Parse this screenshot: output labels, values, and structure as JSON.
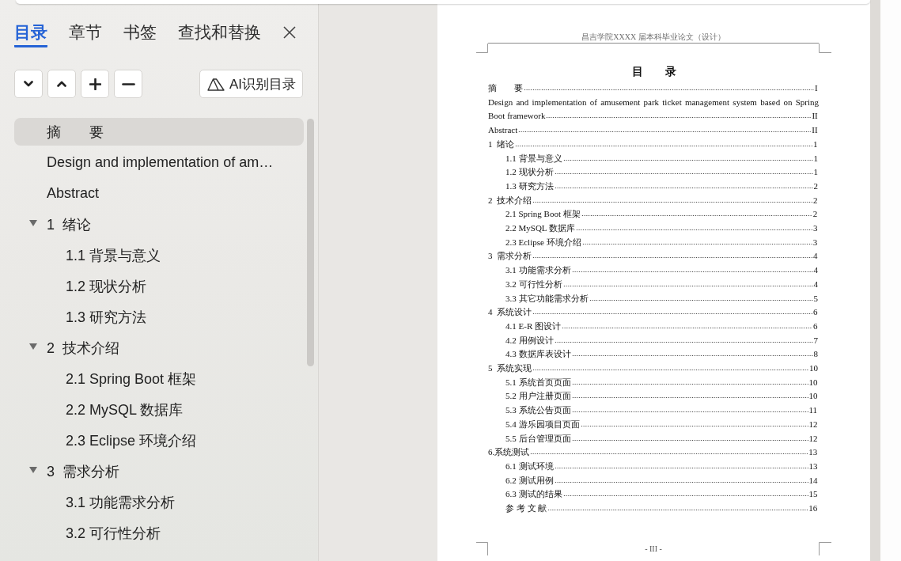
{
  "panel": {
    "tabs": [
      {
        "label": "目录",
        "selected": true
      },
      {
        "label": "章节",
        "selected": false
      },
      {
        "label": "书签",
        "selected": false
      },
      {
        "label": "查找和替换",
        "selected": false
      }
    ],
    "ai_button": "AI识别目录",
    "outline": [
      {
        "label": "摘　　要",
        "selected": true
      },
      {
        "label": "Design and implementation of am…",
        "selected": false
      },
      {
        "label": "Abstract",
        "selected": false
      },
      {
        "label": "1  绪论",
        "selected": false,
        "expanded": true,
        "children": [
          {
            "label": "1.1 背景与意义",
            "selected": false
          },
          {
            "label": "1.2 现状分析",
            "selected": false
          },
          {
            "label": "1.3 研究方法",
            "selected": false
          }
        ]
      },
      {
        "label": "2  技术介绍",
        "selected": false,
        "expanded": true,
        "children": [
          {
            "label": "2.1 Spring Boot 框架",
            "selected": false
          },
          {
            "label": "2.2 MySQL 数据库",
            "selected": false
          },
          {
            "label": "2.3 Eclipse 环境介绍",
            "selected": false
          }
        ]
      },
      {
        "label": "3  需求分析",
        "selected": false,
        "expanded": true,
        "children": [
          {
            "label": "3.1 功能需求分析",
            "selected": false
          },
          {
            "label": "3.2 可行性分析",
            "selected": false
          }
        ]
      }
    ]
  },
  "document": {
    "header": "昌吉学院XXXX 届本科毕业论文（设计）",
    "heading": "目　　录",
    "toc": [
      {
        "title": "摘　　要",
        "page": "I"
      },
      {
        "title": "Design and implementation of amusement park ticket management system based on Spring Boot framework",
        "page": "II"
      },
      {
        "title": "Abstract",
        "page": "II"
      },
      {
        "title": "1  绪论",
        "page": "1",
        "children": [
          {
            "title": "1.1 背景与意义",
            "page": "1"
          },
          {
            "title": "1.2 现状分析",
            "page": "1"
          },
          {
            "title": "1.3 研究方法",
            "page": "2"
          }
        ]
      },
      {
        "title": "2  技术介绍",
        "page": "2",
        "children": [
          {
            "title": "2.1 Spring Boot 框架",
            "page": "2"
          },
          {
            "title": "2.2 MySQL 数据库",
            "page": "3"
          },
          {
            "title": "2.3 Eclipse 环境介绍",
            "page": "3"
          }
        ]
      },
      {
        "title": "3  需求分析",
        "page": "4",
        "children": [
          {
            "title": "3.1 功能需求分析",
            "page": "4"
          },
          {
            "title": "3.2 可行性分析",
            "page": "4"
          },
          {
            "title": "3.3 其它功能需求分析",
            "page": "5"
          }
        ]
      },
      {
        "title": "4  系统设计",
        "page": "6",
        "children": [
          {
            "title": "4.1 E-R 图设计",
            "page": "6"
          },
          {
            "title": "4.2 用例设计",
            "page": "7"
          },
          {
            "title": "4.3 数据库表设计",
            "page": "8"
          }
        ]
      },
      {
        "title": "5  系统实现",
        "page": "10",
        "children": [
          {
            "title": "5.1 系统首页页面",
            "page": "10"
          },
          {
            "title": "5.2 用户注册页面",
            "page": "10"
          },
          {
            "title": "5.3 系统公告页面",
            "page": "11"
          },
          {
            "title": "5.4 游乐园项目页面",
            "page": "12"
          },
          {
            "title": "5.5 后台管理页面",
            "page": "12"
          }
        ]
      },
      {
        "title": "6.系统测试",
        "page": "13",
        "children": [
          {
            "title": "6.1 测试环境",
            "page": "13"
          },
          {
            "title": "6.2 测试用例",
            "page": "14"
          },
          {
            "title": "6.3 测试的结果",
            "page": "15"
          },
          {
            "title": "参 考 文 献",
            "page": "16"
          }
        ]
      }
    ],
    "footer": "- III -"
  }
}
